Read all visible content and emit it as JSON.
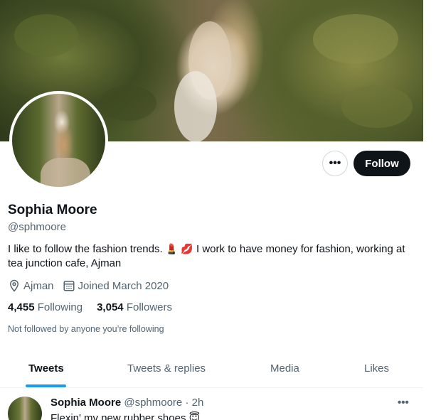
{
  "profile": {
    "name": "Sophia Moore",
    "handle": "@sphmoore",
    "bio_part1": "I like to follow the fashion trends.",
    "bio_emoji1": "💄",
    "bio_emoji2": "💋",
    "bio_part2": "I work to have money for fashion, working at tea junction cafe, Ajman",
    "location": "Ajman",
    "joined": "Joined March 2020",
    "following_count": "4,455",
    "following_label": "Following",
    "followers_count": "3,054",
    "followers_label": "Followers",
    "not_followed": "Not followed by anyone you’re following"
  },
  "actions": {
    "more_label": "•••",
    "follow_label": "Follow"
  },
  "tabs": [
    {
      "label": "Tweets",
      "active": true
    },
    {
      "label": "Tweets & replies",
      "active": false
    },
    {
      "label": "Media",
      "active": false
    },
    {
      "label": "Likes",
      "active": false
    }
  ],
  "tweet": {
    "name": "Sophia Moore",
    "handle": "@sphmoore",
    "separator": "·",
    "time": "2h",
    "more_label": "•••",
    "text": "Flexin' my new rubber shoes",
    "emoji": "😇"
  },
  "icons": {
    "location": "location-pin-icon",
    "calendar": "calendar-icon"
  },
  "colors": {
    "accent": "#1d9bf0",
    "text": "#0f1419",
    "secondary": "#536471",
    "follow_bg": "#0f1419"
  }
}
